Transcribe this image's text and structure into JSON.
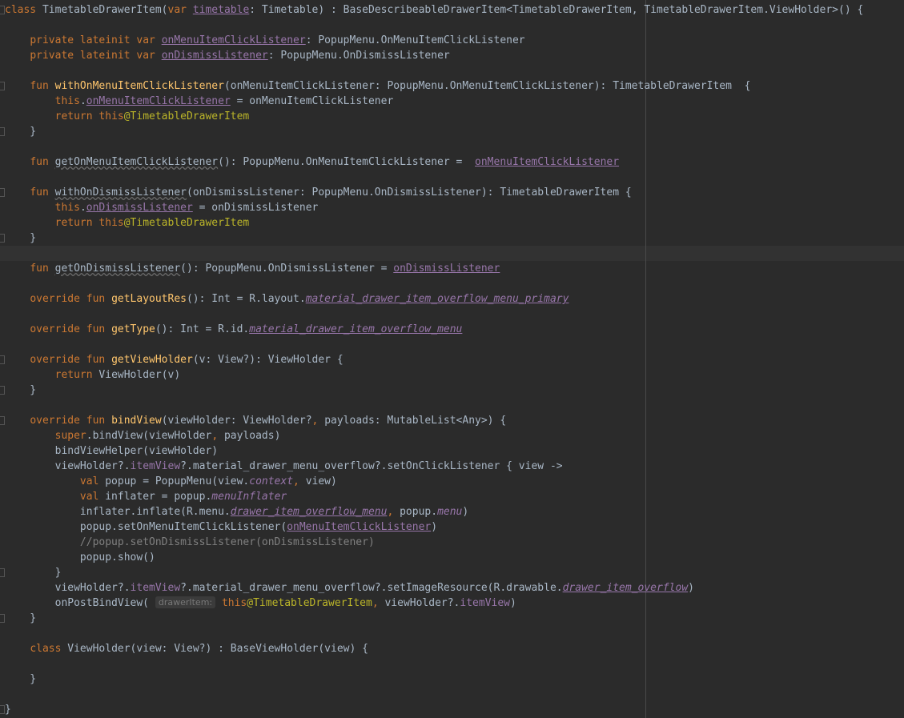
{
  "editor": {
    "language": "Kotlin",
    "colors": {
      "background": "#2b2b2b",
      "default": "#a9b7c6",
      "keyword": "#cc7832",
      "property": "#9876aa",
      "function": "#ffc66d",
      "annotation": "#bbb529",
      "comment": "#808080"
    },
    "highlighted_line": 17,
    "lines": [
      {
        "fold": true,
        "tokens": [
          {
            "t": "class ",
            "c": "kw"
          },
          {
            "t": "TimetableDrawerItem("
          },
          {
            "t": "var ",
            "c": "kw"
          },
          {
            "t": "timetable",
            "c": "prop ul"
          },
          {
            "t": ": Timetable) : BaseDescribeableDrawerItem<TimetableDrawerItem, TimetableDrawerItem.ViewHolder>() {"
          }
        ]
      },
      {
        "tokens": []
      },
      {
        "tokens": [
          {
            "t": "    "
          },
          {
            "t": "private lateinit var ",
            "c": "kw"
          },
          {
            "t": "onMenuItemClickListener",
            "c": "prop ul"
          },
          {
            "t": ": PopupMenu.OnMenuItemClickListener"
          }
        ]
      },
      {
        "tokens": [
          {
            "t": "    "
          },
          {
            "t": "private lateinit var ",
            "c": "kw"
          },
          {
            "t": "onDismissListener",
            "c": "prop ul"
          },
          {
            "t": ": PopupMenu.OnDismissListener"
          }
        ]
      },
      {
        "tokens": []
      },
      {
        "fold": true,
        "tokens": [
          {
            "t": "    "
          },
          {
            "t": "fun ",
            "c": "kw"
          },
          {
            "t": "withOnMenuItemClickListener",
            "c": "fn"
          },
          {
            "t": "(onMenuItemClickListener: PopupMenu.OnMenuItemClickListener): TimetableDrawerItem  {"
          }
        ]
      },
      {
        "tokens": [
          {
            "t": "        "
          },
          {
            "t": "this",
            "c": "kw"
          },
          {
            "t": "."
          },
          {
            "t": "onMenuItemClickListener",
            "c": "prop ul"
          },
          {
            "t": " = onMenuItemClickListener"
          }
        ]
      },
      {
        "tokens": [
          {
            "t": "        "
          },
          {
            "t": "return this",
            "c": "kw"
          },
          {
            "t": "@TimetableDrawerItem",
            "c": "ann"
          }
        ]
      },
      {
        "fold": true,
        "tokens": [
          {
            "t": "    }"
          }
        ]
      },
      {
        "tokens": []
      },
      {
        "tokens": [
          {
            "t": "    "
          },
          {
            "t": "fun ",
            "c": "kw"
          },
          {
            "t": "getOnMenuItemClickListener",
            "c": "warn"
          },
          {
            "t": "(): PopupMenu.OnMenuItemClickListener =  "
          },
          {
            "t": "onMenuItemClickListener",
            "c": "prop ul"
          }
        ]
      },
      {
        "tokens": []
      },
      {
        "fold": true,
        "tokens": [
          {
            "t": "    "
          },
          {
            "t": "fun ",
            "c": "kw"
          },
          {
            "t": "withOnDismissListener",
            "c": "warn"
          },
          {
            "t": "(onDismissListener: PopupMenu.OnDismissListener): TimetableDrawerItem {"
          }
        ]
      },
      {
        "tokens": [
          {
            "t": "        "
          },
          {
            "t": "this",
            "c": "kw"
          },
          {
            "t": "."
          },
          {
            "t": "onDismissListener",
            "c": "prop ul"
          },
          {
            "t": " = onDismissListener"
          }
        ]
      },
      {
        "tokens": [
          {
            "t": "        "
          },
          {
            "t": "return this",
            "c": "kw"
          },
          {
            "t": "@TimetableDrawerItem",
            "c": "ann"
          }
        ]
      },
      {
        "fold": true,
        "tokens": [
          {
            "t": "    }"
          }
        ]
      },
      {
        "tokens": []
      },
      {
        "tokens": [
          {
            "t": "    "
          },
          {
            "t": "fun ",
            "c": "kw"
          },
          {
            "t": "getOnDismissListener",
            "c": "warn"
          },
          {
            "t": "(): PopupMenu.OnDismissListener = "
          },
          {
            "t": "onDismissListener",
            "c": "prop ul"
          }
        ]
      },
      {
        "tokens": []
      },
      {
        "tokens": [
          {
            "t": "    "
          },
          {
            "t": "override fun ",
            "c": "kw"
          },
          {
            "t": "getLayoutRes",
            "c": "fn"
          },
          {
            "t": "(): Int = R.layout."
          },
          {
            "t": "material_drawer_item_overflow_menu_primary",
            "c": "prop ital ul"
          }
        ]
      },
      {
        "tokens": []
      },
      {
        "tokens": [
          {
            "t": "    "
          },
          {
            "t": "override fun ",
            "c": "kw"
          },
          {
            "t": "getType",
            "c": "fn"
          },
          {
            "t": "(): Int = R.id."
          },
          {
            "t": "material_drawer_item_overflow_menu",
            "c": "prop ital ul"
          }
        ]
      },
      {
        "tokens": []
      },
      {
        "fold": true,
        "tokens": [
          {
            "t": "    "
          },
          {
            "t": "override fun ",
            "c": "kw"
          },
          {
            "t": "getViewHolder",
            "c": "fn"
          },
          {
            "t": "(v: View?): ViewHolder {"
          }
        ]
      },
      {
        "tokens": [
          {
            "t": "        "
          },
          {
            "t": "return ",
            "c": "kw"
          },
          {
            "t": "ViewHolder(v)"
          }
        ]
      },
      {
        "fold": true,
        "tokens": [
          {
            "t": "    }"
          }
        ]
      },
      {
        "tokens": []
      },
      {
        "fold": true,
        "tokens": [
          {
            "t": "    "
          },
          {
            "t": "override fun ",
            "c": "kw"
          },
          {
            "t": "bindView",
            "c": "fn"
          },
          {
            "t": "(viewHolder: ViewHolder?"
          },
          {
            "t": ", ",
            "c": "kw"
          },
          {
            "t": "payloads: MutableList<Any>) {"
          }
        ]
      },
      {
        "tokens": [
          {
            "t": "        "
          },
          {
            "t": "super",
            "c": "kw"
          },
          {
            "t": ".bindView(viewHolder"
          },
          {
            "t": ", ",
            "c": "kw"
          },
          {
            "t": "payloads)"
          }
        ]
      },
      {
        "tokens": [
          {
            "t": "        bindViewHelper(viewHolder)"
          }
        ]
      },
      {
        "tokens": [
          {
            "t": "        viewHolder?."
          },
          {
            "t": "itemView",
            "c": "prop"
          },
          {
            "t": "?.material_drawer_menu_overflow?.setOnClickListener { view ->"
          }
        ]
      },
      {
        "tokens": [
          {
            "t": "            "
          },
          {
            "t": "val ",
            "c": "kw"
          },
          {
            "t": "popup = PopupMenu(view."
          },
          {
            "t": "context",
            "c": "prop ital"
          },
          {
            "t": ", ",
            "c": "kw"
          },
          {
            "t": "view)"
          }
        ]
      },
      {
        "tokens": [
          {
            "t": "            "
          },
          {
            "t": "val ",
            "c": "kw"
          },
          {
            "t": "inflater = popup."
          },
          {
            "t": "menuInflater",
            "c": "prop ital"
          }
        ]
      },
      {
        "tokens": [
          {
            "t": "            inflater.inflate(R.menu."
          },
          {
            "t": "drawer_item_overflow_menu",
            "c": "prop ital ul"
          },
          {
            "t": ", ",
            "c": "kw"
          },
          {
            "t": "popup."
          },
          {
            "t": "menu",
            "c": "prop ital"
          },
          {
            "t": ")"
          }
        ]
      },
      {
        "tokens": [
          {
            "t": "            popup.setOnMenuItemClickListener("
          },
          {
            "t": "onMenuItemClickListener",
            "c": "prop ul"
          },
          {
            "t": ")"
          }
        ]
      },
      {
        "tokens": [
          {
            "t": "            "
          },
          {
            "t": "//popup.setOnDismissListener(onDismissListener)",
            "c": "comment"
          }
        ]
      },
      {
        "tokens": [
          {
            "t": "            popup.show()"
          }
        ]
      },
      {
        "fold": true,
        "tokens": [
          {
            "t": "        }"
          }
        ]
      },
      {
        "tokens": [
          {
            "t": "        viewHolder?."
          },
          {
            "t": "itemView",
            "c": "prop"
          },
          {
            "t": "?.material_drawer_menu_overflow?.setImageResource(R.drawable."
          },
          {
            "t": "drawer_item_overflow",
            "c": "prop ital ul"
          },
          {
            "t": ")"
          }
        ]
      },
      {
        "tokens": [
          {
            "t": "        onPostBindView( "
          },
          {
            "t": "drawerItem:",
            "c": "hint"
          },
          {
            "t": " "
          },
          {
            "t": "this",
            "c": "kw"
          },
          {
            "t": "@TimetableDrawerItem",
            "c": "ann"
          },
          {
            "t": ", ",
            "c": "kw"
          },
          {
            "t": "viewHolder?."
          },
          {
            "t": "itemView",
            "c": "prop"
          },
          {
            "t": ")"
          }
        ]
      },
      {
        "fold": true,
        "tokens": [
          {
            "t": "    }"
          }
        ]
      },
      {
        "tokens": []
      },
      {
        "tokens": [
          {
            "t": "    "
          },
          {
            "t": "class ",
            "c": "kw"
          },
          {
            "t": "ViewHolder(view: View?) : BaseViewHolder(view) {"
          }
        ]
      },
      {
        "tokens": []
      },
      {
        "tokens": [
          {
            "t": "    }"
          }
        ]
      },
      {
        "tokens": []
      },
      {
        "fold": true,
        "tokens": [
          {
            "t": "}"
          }
        ]
      }
    ]
  }
}
